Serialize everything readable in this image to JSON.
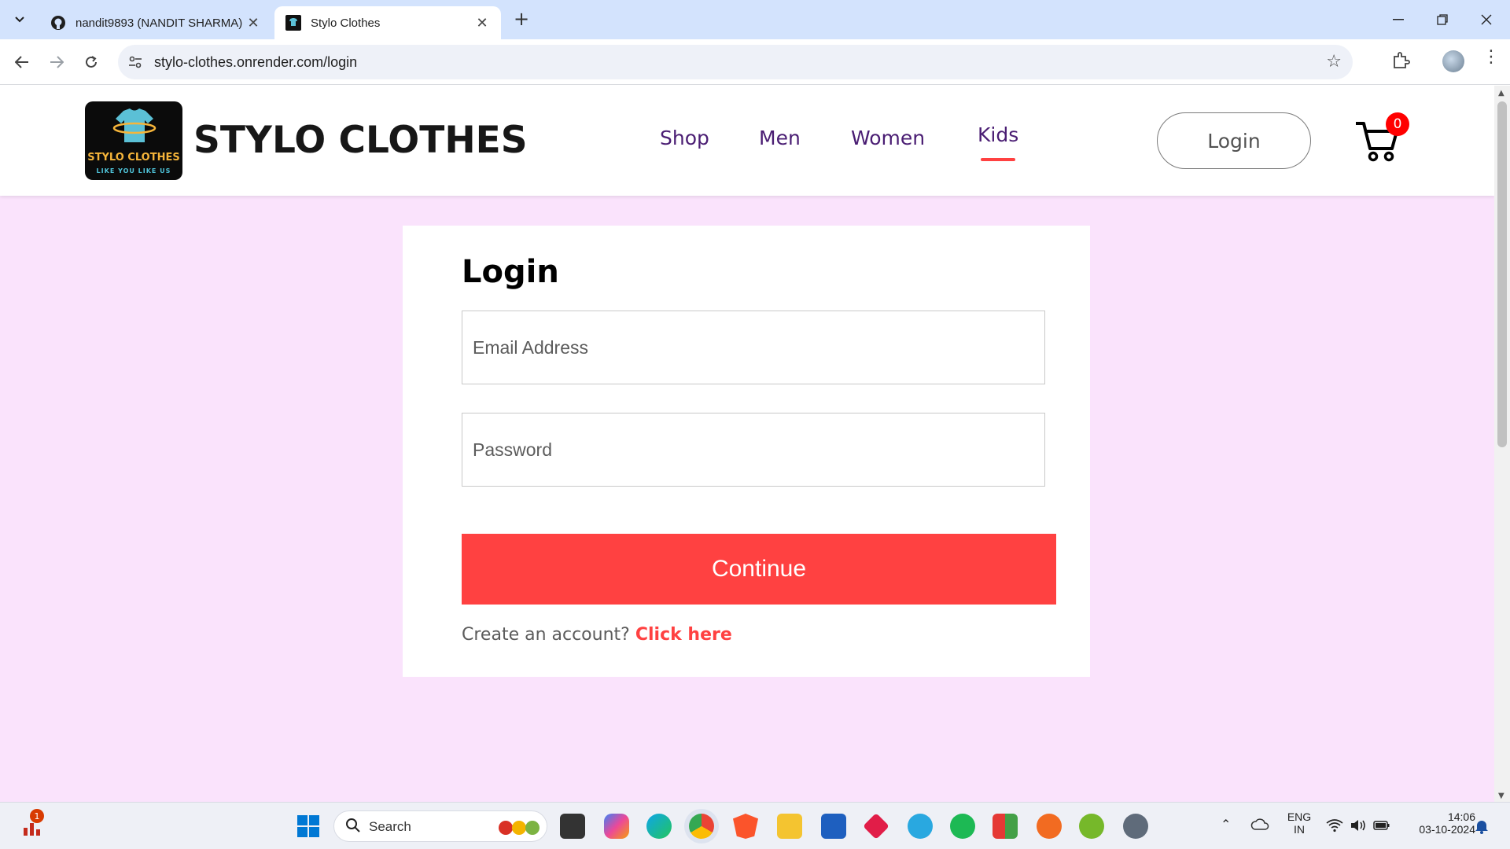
{
  "browser": {
    "tabs": [
      {
        "title": "nandit9893 (NANDIT SHARMA)",
        "icon": "github-icon",
        "active": false
      },
      {
        "title": "Stylo Clothes",
        "icon": "stylo-favicon",
        "active": true
      }
    ],
    "url": "stylo-clothes.onrender.com/login"
  },
  "header": {
    "logo_name": "STYLO CLOTHES",
    "logo_tagline": "LIKE YOU LIKE US",
    "brand": "STYLO CLOTHES",
    "nav": [
      "Shop",
      "Men",
      "Women",
      "Kids"
    ],
    "active_nav": "Kids",
    "login_label": "Login",
    "cart_count": "0"
  },
  "login": {
    "title": "Login",
    "email_placeholder": "Email Address",
    "password_placeholder": "Password",
    "continue_label": "Continue",
    "signup_prompt": "Create an account?",
    "signup_link": "Click here"
  },
  "taskbar": {
    "search_label": "Search",
    "notification_count": "1",
    "language": "ENG",
    "region": "IN",
    "time": "14:06",
    "date": "03-10-2024"
  },
  "colors": {
    "accent": "#ff4141",
    "page_bg": "#fae3fc",
    "nav_text": "#4a1d73"
  }
}
